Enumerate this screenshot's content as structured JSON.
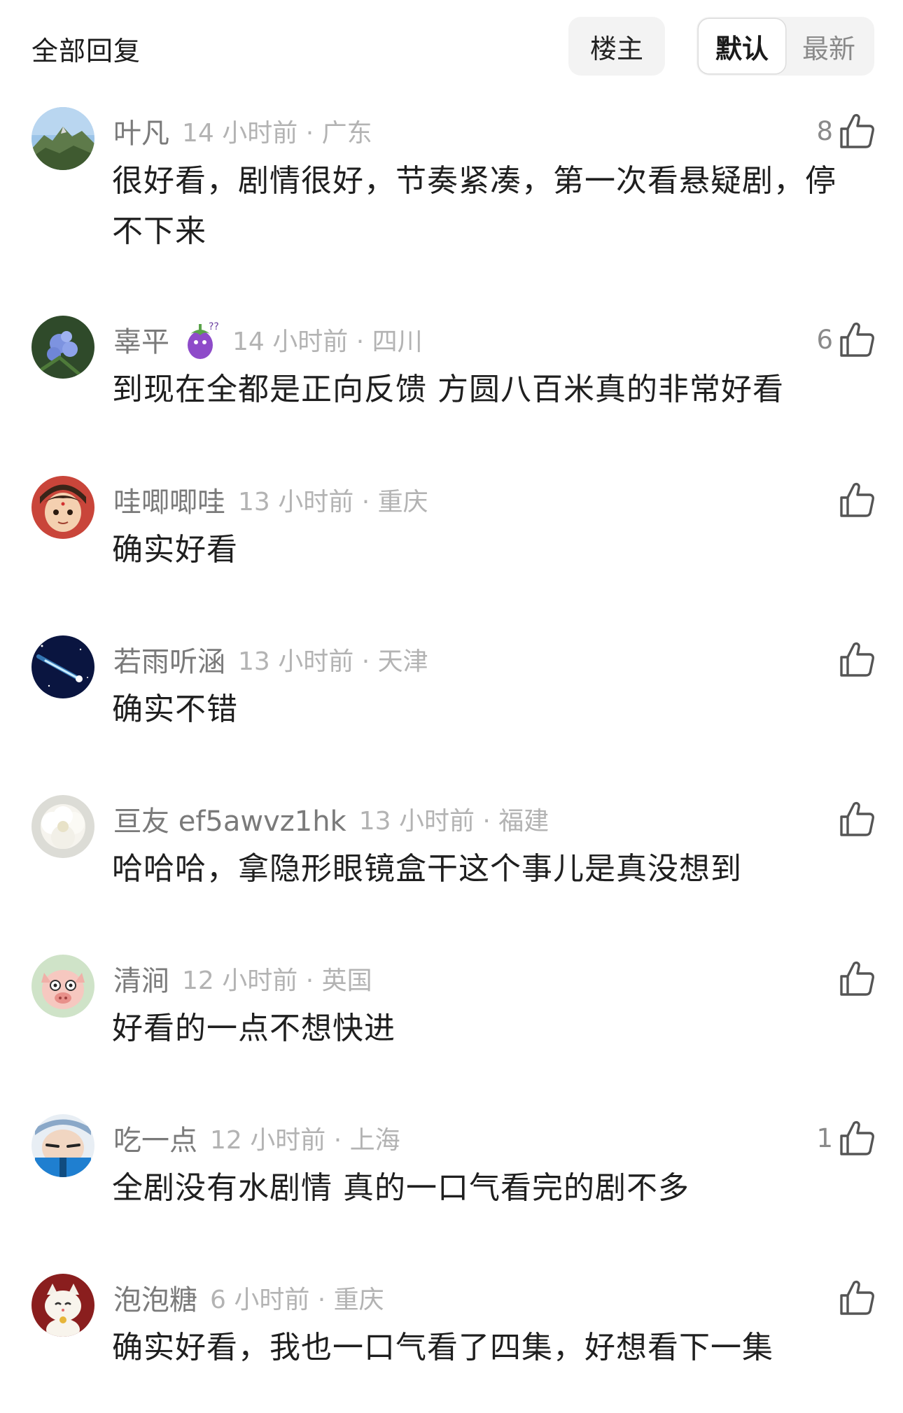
{
  "header": {
    "title": "全部回复",
    "owner_filter": "楼主",
    "sort_default": "默认",
    "sort_latest": "最新"
  },
  "comments": [
    {
      "user": "叶凡",
      "time": "14 小时前 · 广东",
      "likes": "8",
      "text": "很好看，剧情很好，节奏紧凑，第一次看悬疑剧，停不下来"
    },
    {
      "user": "辜平",
      "time": "14 小时前 · 四川",
      "likes": "6",
      "text": "到现在全都是正向反馈 方圆八百米真的非常好看",
      "badge": "eggplant-badge"
    },
    {
      "user": "哇唧唧哇",
      "time": "13 小时前 · 重庆",
      "likes": "",
      "text": "确实好看"
    },
    {
      "user": "若雨听涵",
      "time": "13 小时前 · 天津",
      "likes": "",
      "text": "确实不错"
    },
    {
      "user": "亘友 ef5awvz1hk",
      "time": "13 小时前 · 福建",
      "likes": "",
      "text": "哈哈哈，拿隐形眼镜盒干这个事儿是真没想到"
    },
    {
      "user": "清涧",
      "time": "12 小时前 · 英国",
      "likes": "",
      "text": "好看的一点不想快进"
    },
    {
      "user": "吃一点",
      "time": "12 小时前 · 上海",
      "likes": "1",
      "text": "全剧没有水剧情 真的一口气看完的剧不多"
    },
    {
      "user": "泡泡糖",
      "time": "6 小时前 · 重庆",
      "likes": "",
      "text": "确实好看，我也一口气看了四集，好想看下一集"
    }
  ]
}
